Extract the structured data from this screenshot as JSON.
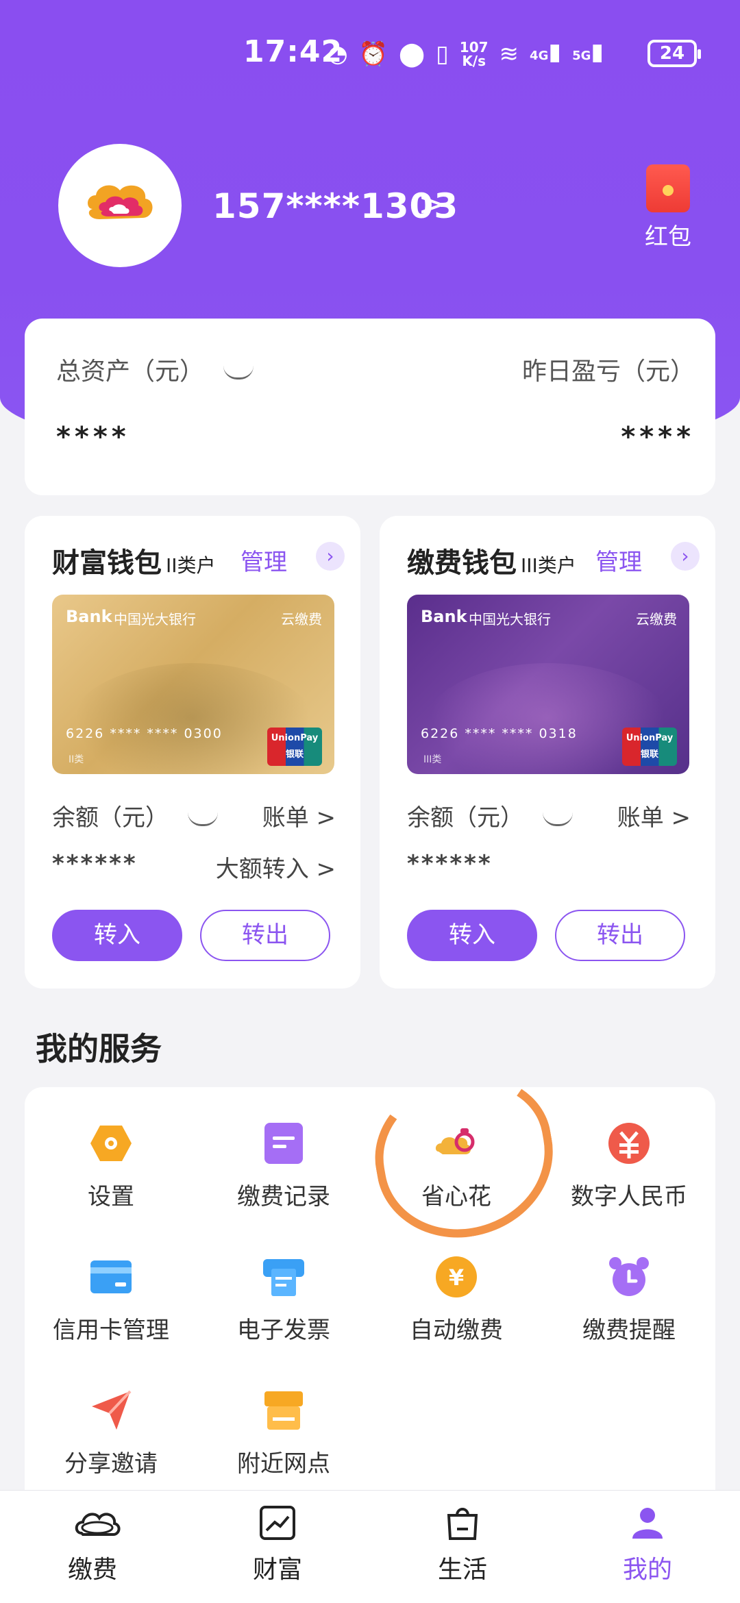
{
  "status_bar": {
    "time": "17:42",
    "net_speed_top": "107",
    "net_speed_bottom": "K/s",
    "sig1": "4G",
    "sig2": "5G",
    "battery": "24"
  },
  "profile": {
    "phone": "157****1303",
    "arrow": ">",
    "red_packet_label": "红包"
  },
  "assets": {
    "total_label": "总资产（元）",
    "total_value": "****",
    "yesterday_label": "昨日盈亏（元）",
    "yesterday_value": "****"
  },
  "wallets": [
    {
      "title": "财富钱包",
      "class_label": "II类户",
      "manage_label": "管理",
      "card": {
        "bank_logo": "Bank",
        "bank_name": "中国光大银行",
        "brand": "云缴费",
        "number": "6226 **** **** 0300",
        "class_mark": "II类",
        "unionpay": "UnionPay 银联"
      },
      "balance_label": "余额（元）",
      "bill_label": "账单 >",
      "balance_value": "******",
      "big_transfer_label": "大额转入 >",
      "in_label": "转入",
      "out_label": "转出"
    },
    {
      "title": "缴费钱包",
      "class_label": "III类户",
      "manage_label": "管理",
      "card": {
        "bank_logo": "Bank",
        "bank_name": "中国光大银行",
        "brand": "云缴费",
        "number": "6226 **** **** 0318",
        "class_mark": "III类",
        "unionpay": "UnionPay 银联"
      },
      "balance_label": "余额（元）",
      "bill_label": "账单 >",
      "balance_value": "******",
      "in_label": "转入",
      "out_label": "转出"
    }
  ],
  "services": {
    "title": "我的服务",
    "items": [
      {
        "label": "设置",
        "icon": "gear-hexagon-icon",
        "color": "#f7a823"
      },
      {
        "label": "缴费记录",
        "icon": "record-icon",
        "color": "#a56ef5"
      },
      {
        "label": "省心花",
        "icon": "sheng-xin-hua-icon",
        "color": "#f3b23a"
      },
      {
        "label": "数字人民币",
        "icon": "digital-rmb-icon",
        "color": "#ef5a4a"
      },
      {
        "label": "信用卡管理",
        "icon": "credit-card-icon",
        "color": "#3aa0f5"
      },
      {
        "label": "电子发票",
        "icon": "invoice-icon",
        "color": "#3aa0f5"
      },
      {
        "label": "自动缴费",
        "icon": "auto-pay-icon",
        "color": "#f7a823"
      },
      {
        "label": "缴费提醒",
        "icon": "alarm-clock-icon",
        "color": "#a56ef5"
      },
      {
        "label": "分享邀请",
        "icon": "share-arrow-icon",
        "color": "#ef5a4a"
      },
      {
        "label": "附近网点",
        "icon": "store-icon",
        "color": "#f7a823"
      }
    ]
  },
  "tabbar": {
    "items": [
      {
        "label": "缴费",
        "icon": "cloud-icon"
      },
      {
        "label": "财富",
        "icon": "chart-icon"
      },
      {
        "label": "生活",
        "icon": "shopping-bag-icon"
      },
      {
        "label": "我的",
        "icon": "person-icon",
        "active": true
      }
    ]
  },
  "colors": {
    "accent": "#8b55f0",
    "annotation": "#f39347"
  }
}
